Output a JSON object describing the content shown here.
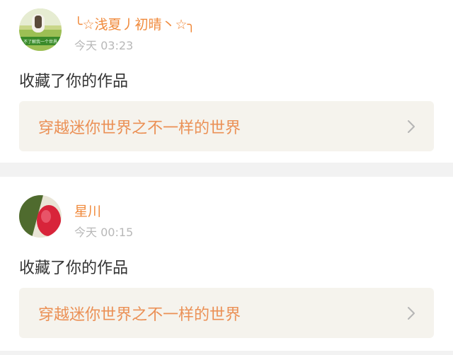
{
  "notifications": [
    {
      "username": "╰☆浅夏丿初晴丶☆╮",
      "time": "今天 03:23",
      "action": "收藏了你的作品",
      "work_title": "穿越迷你世界之不一样的世界",
      "avatar_caption": "不了解我一个世界"
    },
    {
      "username": "星川",
      "time": "今天 00:15",
      "action": "收藏了你的作品",
      "work_title": "穿越迷你世界之不一样的世界"
    }
  ],
  "icons": {
    "arrow": "chevron-right-icon"
  },
  "colors": {
    "username": "#f08a3c",
    "work_title": "#eb9055",
    "time": "#b8b8b8",
    "action": "#333333",
    "card_link_bg": "#f5f3ed",
    "page_bg": "#f2f2f2"
  }
}
